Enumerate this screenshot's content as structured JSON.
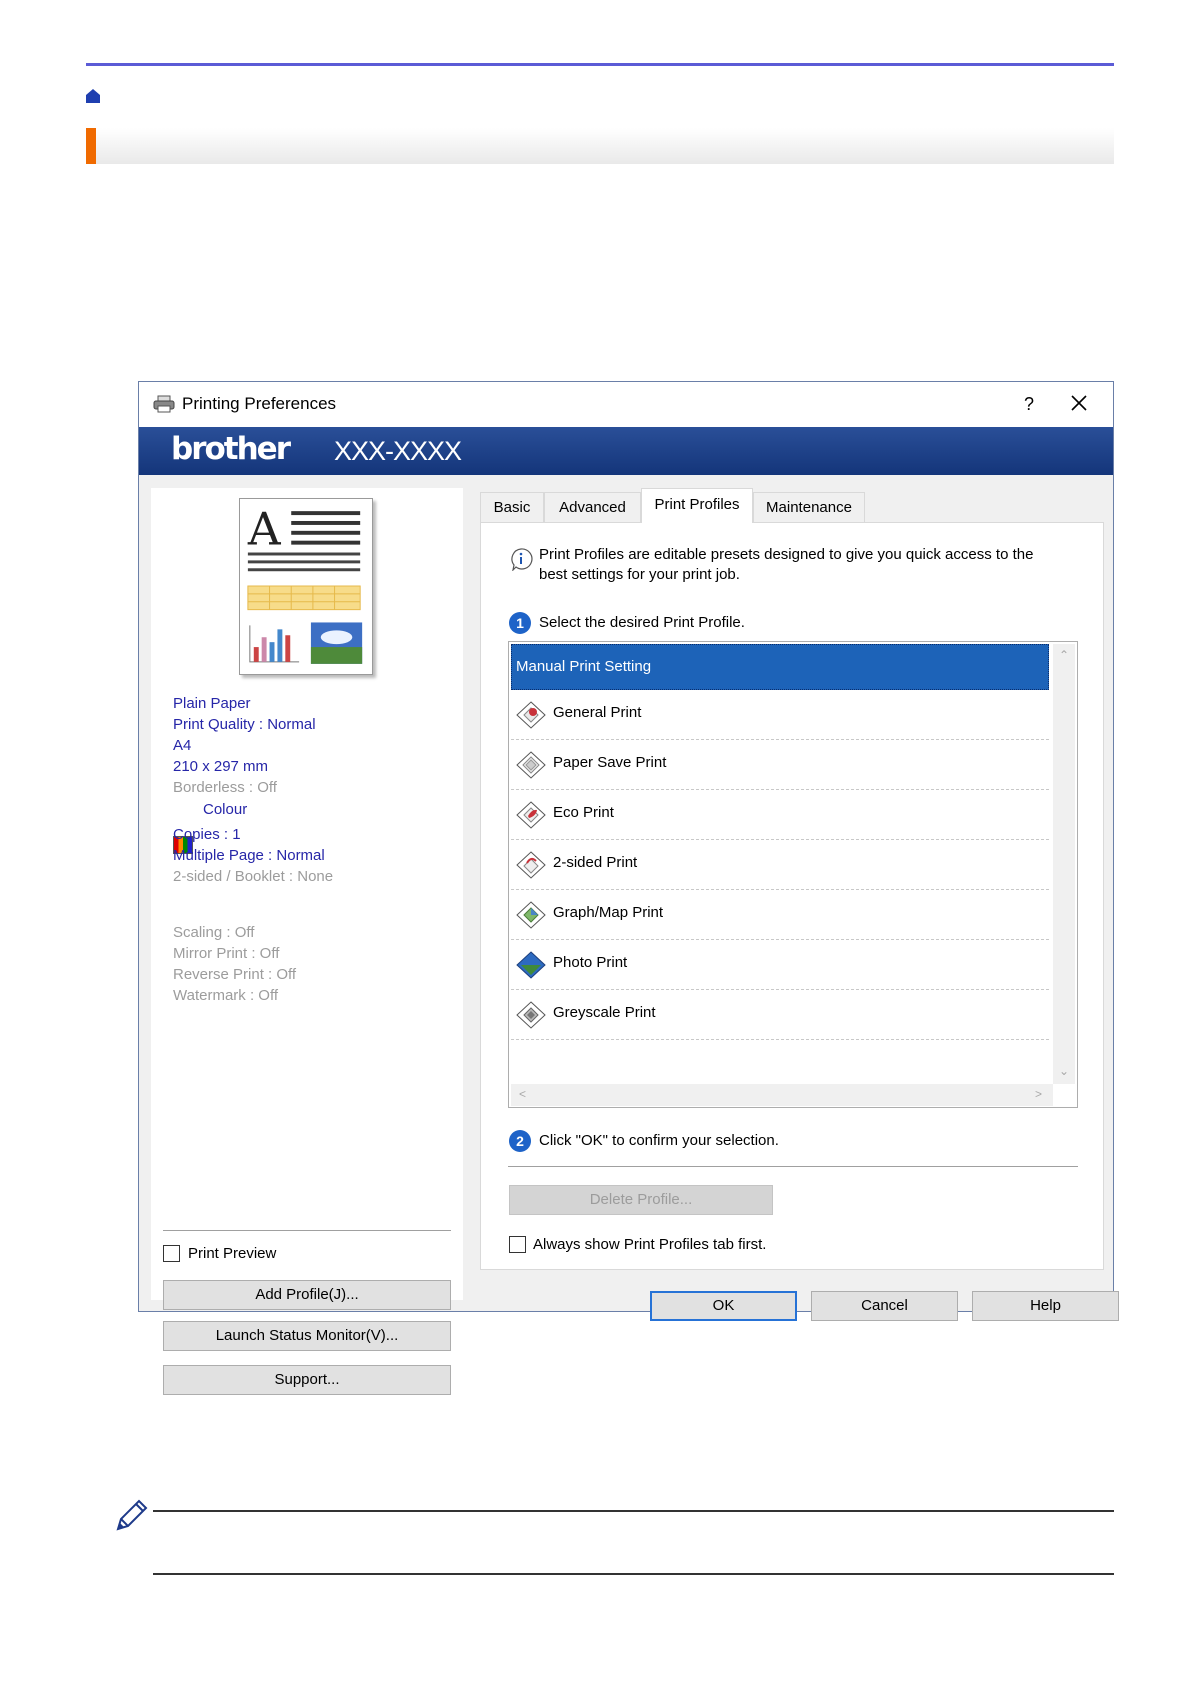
{
  "header": {
    "home_icon": "home-icon",
    "accent_color": "#f06a00",
    "rule_color": "#5b5bd6"
  },
  "dialog": {
    "title": "Printing Preferences",
    "help_button": "?",
    "brand": "brother",
    "model": "XXX-XXXX",
    "settings_summary": {
      "paper_type": "Plain Paper",
      "print_quality": "Print Quality : Normal",
      "paper_size": "A4",
      "dimensions": "210 x 297 mm",
      "borderless": "Borderless : Off",
      "colour": "Colour",
      "copies": "Copies : 1",
      "multiple_page": "Multiple Page : Normal",
      "two_sided": "2-sided / Booklet : None",
      "scaling": "Scaling : Off",
      "mirror_print": "Mirror Print : Off",
      "reverse_print": "Reverse Print : Off",
      "watermark": "Watermark : Off"
    },
    "print_preview_label": "Print Preview",
    "add_profile_button": "Add Profile(J)...",
    "launch_status_monitor_button": "Launch Status Monitor(V)...",
    "support_button": "Support...",
    "tabs": [
      {
        "label": "Basic"
      },
      {
        "label": "Advanced"
      },
      {
        "label": "Print Profiles"
      },
      {
        "label": "Maintenance"
      }
    ],
    "intro_text": "Print Profiles are editable presets designed to give you quick access to the best settings for your print job.",
    "step1": {
      "number": "1",
      "text": "Select the desired Print Profile."
    },
    "profiles": [
      {
        "label": "Manual Print Setting",
        "icon": "manual-setting"
      },
      {
        "label": "General Print",
        "icon": "general-print-icon"
      },
      {
        "label": "Paper Save Print",
        "icon": "paper-save-icon"
      },
      {
        "label": "Eco Print",
        "icon": "eco-print-icon"
      },
      {
        "label": "2-sided Print",
        "icon": "two-sided-print-icon"
      },
      {
        "label": "Graph/Map Print",
        "icon": "graph-map-print-icon"
      },
      {
        "label": "Photo Print",
        "icon": "photo-print-icon"
      },
      {
        "label": "Greyscale Print",
        "icon": "greyscale-print-icon"
      }
    ],
    "step2": {
      "number": "2",
      "text": "Click \"OK\" to confirm your selection."
    },
    "delete_profile_button": "Delete Profile...",
    "always_show_label": "Always show Print Profiles tab first.",
    "ok_button": "OK",
    "cancel_button": "Cancel",
    "help_label": "Help"
  },
  "note": {
    "icon": "pencil-icon"
  }
}
